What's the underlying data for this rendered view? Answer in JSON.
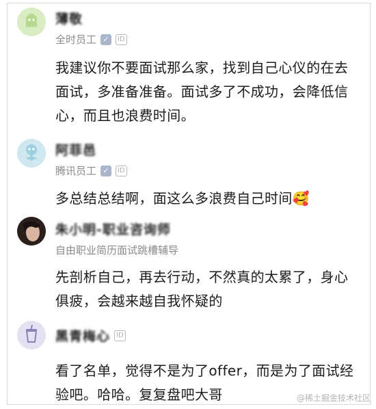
{
  "comments": [
    {
      "name": "薄敬",
      "subtitle": "全时员工",
      "verified_icon": "check-badge",
      "id_badge": "ID",
      "body": "我建议你不要面试那么家，找到自己心仪的在去面试，多准备准备。面试多了不成功，会降低信心，而且也浪费时间。"
    },
    {
      "name": "阿菲邑",
      "subtitle": "腾讯员工",
      "verified_icon": "check-badge",
      "id_badge": "ID",
      "body": "多总结总结啊，面这么多浪费自己时间🥰"
    },
    {
      "name": "朱小明-职业咨询师",
      "subtitle": "自由职业简历面试跳槽辅导",
      "body": "先剖析自己，再去行动，不然真的太累了，身心俱疲，会越来越自我怀疑的"
    },
    {
      "name": "黑青梅心",
      "id_badge": "ID",
      "body": "看了名单，觉得不是为了offer，而是为了面试经验吧。哈哈。复复盘吧大哥"
    }
  ],
  "watermark": "@稀土掘金技术社区",
  "colors": {
    "avatar1_bg": "#d9ecc3",
    "avatar2_bg": "#cfe8ef",
    "avatar4_bg": "#e4e1f2",
    "badge_v": "#aab6cc"
  }
}
